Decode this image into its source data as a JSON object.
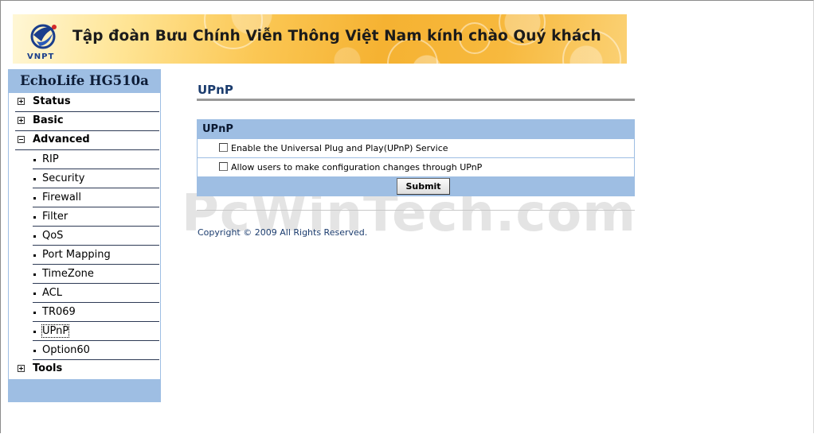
{
  "banner": {
    "logo_text": "VNPT",
    "greeting": "Tập đoàn Bưu Chính Viễn Thông Việt Nam kính chào Quý khách"
  },
  "sidebar": {
    "title": "EchoLife HG510a",
    "sections": [
      {
        "label": "Status",
        "icon": "plus-expand-icon",
        "expanded": false
      },
      {
        "label": "Basic",
        "icon": "plus-expand-icon",
        "expanded": false
      },
      {
        "label": "Advanced",
        "icon": "minus-collapse-icon",
        "expanded": true
      },
      {
        "label": "Tools",
        "icon": "plus-expand-icon",
        "expanded": false
      }
    ],
    "advanced_items": [
      {
        "label": "RIP"
      },
      {
        "label": "Security"
      },
      {
        "label": "Firewall"
      },
      {
        "label": "Filter"
      },
      {
        "label": "QoS"
      },
      {
        "label": "Port Mapping"
      },
      {
        "label": "TimeZone"
      },
      {
        "label": "ACL"
      },
      {
        "label": "TR069"
      },
      {
        "label": "UPnP",
        "selected": true
      },
      {
        "label": "Option60"
      }
    ]
  },
  "main": {
    "page_title": "UPnP",
    "panel": {
      "header": "UPnP",
      "options": [
        {
          "label": "Enable the Universal Plug and Play(UPnP) Service",
          "checked": false
        },
        {
          "label": "Allow users to make configuration changes through UPnP",
          "checked": false
        }
      ],
      "submit_label": "Submit"
    },
    "copyright": "Copyright © 2009 All Rights Reserved."
  },
  "watermark": "PcWinTech.com",
  "colors": {
    "sidebar_bg": "#9ebee3",
    "title_color": "#1b3c6e",
    "banner_gold": "#f5b232"
  }
}
